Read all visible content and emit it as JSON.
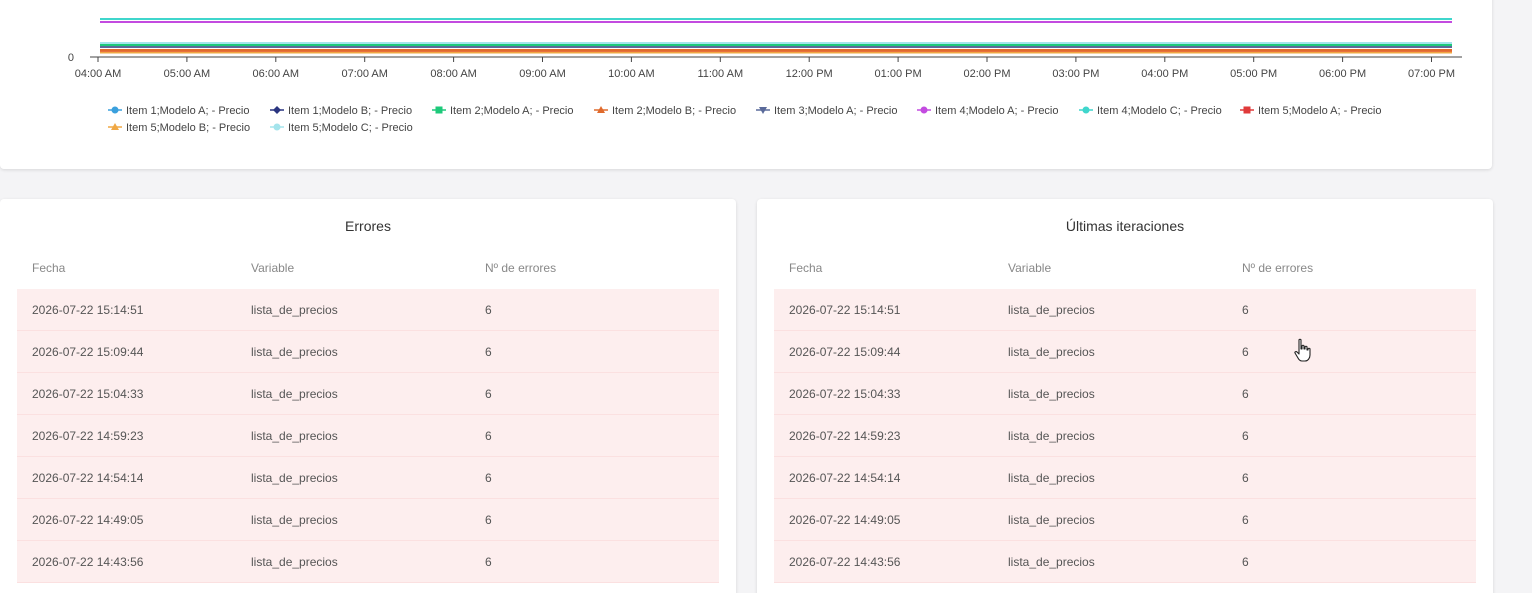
{
  "chart_data": {
    "type": "line",
    "x": [
      "04:00 AM",
      "05:00 AM",
      "06:00 AM",
      "07:00 AM",
      "08:00 AM",
      "09:00 AM",
      "10:00 AM",
      "11:00 AM",
      "12:00 PM",
      "01:00 PM",
      "02:00 PM",
      "03:00 PM",
      "04:00 PM",
      "05:00 PM",
      "06:00 PM",
      "07:00 PM"
    ],
    "y_tick_labels": [
      "0"
    ],
    "series": [
      {
        "name": "Item 1;Modelo A; - Precio",
        "color": "#3ba0dd",
        "marker": "circle",
        "level": 3
      },
      {
        "name": "Item 1;Modelo B; - Precio",
        "color": "#2a3580",
        "marker": "diamond",
        "level": 2
      },
      {
        "name": "Item 2;Modelo A; - Precio",
        "color": "#1dc97a",
        "marker": "square",
        "level": 8
      },
      {
        "name": "Item 2;Modelo B; - Precio",
        "color": "#e06a2c",
        "marker": "triangle",
        "level": 3
      },
      {
        "name": "Item 3;Modelo A; - Precio",
        "color": "#5a6a9a",
        "marker": "triangle-down",
        "level": 6
      },
      {
        "name": "Item 4;Modelo A; - Precio",
        "color": "#c34be0",
        "marker": "circle",
        "level": 31
      },
      {
        "name": "Item 4;Modelo C; - Precio",
        "color": "#3fd6cc",
        "marker": "circle",
        "level": 34
      },
      {
        "name": "Item 5;Modelo A; - Precio",
        "color": "#e03a3a",
        "marker": "square",
        "level": 1
      },
      {
        "name": "Item 5;Modelo B; - Precio",
        "color": "#f0a844",
        "marker": "triangle",
        "level": 0.5
      },
      {
        "name": "Item 5;Modelo C; - Precio",
        "color": "#a4e4ec",
        "marker": "circle",
        "level": 10
      }
    ]
  },
  "errors_table": {
    "title": "Errores",
    "headers": [
      "Fecha",
      "Variable",
      "Nº de errores"
    ],
    "rows": [
      [
        "2026-07-22 15:14:51",
        "lista_de_precios",
        "6"
      ],
      [
        "2026-07-22 15:09:44",
        "lista_de_precios",
        "6"
      ],
      [
        "2026-07-22 15:04:33",
        "lista_de_precios",
        "6"
      ],
      [
        "2026-07-22 14:59:23",
        "lista_de_precios",
        "6"
      ],
      [
        "2026-07-22 14:54:14",
        "lista_de_precios",
        "6"
      ],
      [
        "2026-07-22 14:49:05",
        "lista_de_precios",
        "6"
      ],
      [
        "2026-07-22 14:43:56",
        "lista_de_precios",
        "6"
      ]
    ]
  },
  "iterations_table": {
    "title": "Últimas iteraciones",
    "headers": [
      "Fecha",
      "Variable",
      "Nº de errores"
    ],
    "rows": [
      [
        "2026-07-22 15:14:51",
        "lista_de_precios",
        "6"
      ],
      [
        "2026-07-22 15:09:44",
        "lista_de_precios",
        "6"
      ],
      [
        "2026-07-22 15:04:33",
        "lista_de_precios",
        "6"
      ],
      [
        "2026-07-22 14:59:23",
        "lista_de_precios",
        "6"
      ],
      [
        "2026-07-22 14:54:14",
        "lista_de_precios",
        "6"
      ],
      [
        "2026-07-22 14:49:05",
        "lista_de_precios",
        "6"
      ],
      [
        "2026-07-22 14:43:56",
        "lista_de_precios",
        "6"
      ]
    ]
  }
}
